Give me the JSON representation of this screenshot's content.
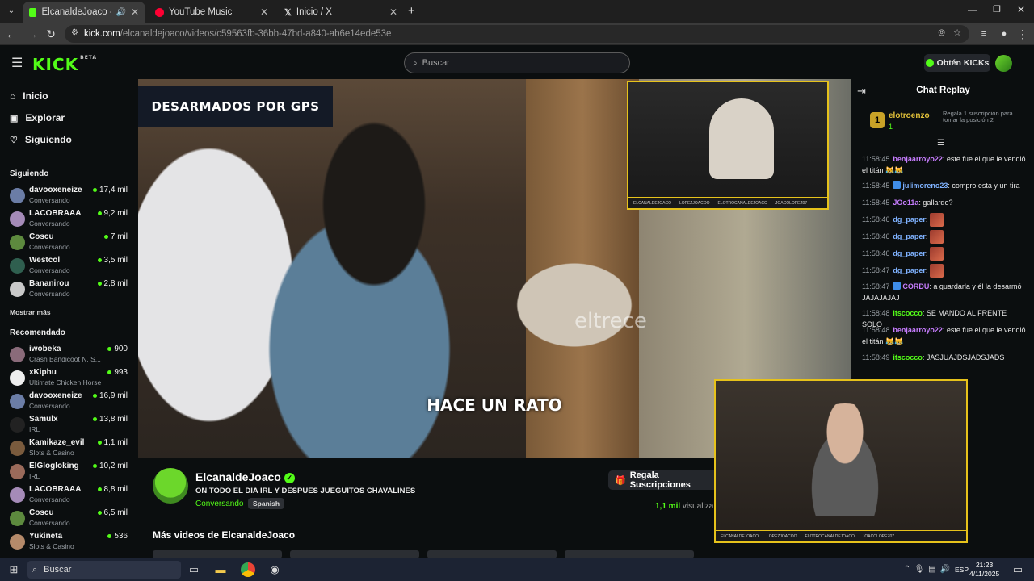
{
  "browser": {
    "tabs": [
      {
        "title": "ElcanaldeJoaco - Watch the"
      },
      {
        "title": "YouTube Music"
      },
      {
        "title": "Inicio / X"
      }
    ],
    "url_host": "kick.com",
    "url_path": "/elcanaldejoaco/videos/c59563fb-36bb-47bd-a840-ab6e14ede53e"
  },
  "header": {
    "logo": "KICK",
    "logo_tag": "BETA",
    "search_placeholder": "Buscar",
    "get_kicks": "Obtén KICKs"
  },
  "sidebar": {
    "nav": [
      {
        "label": "Inicio",
        "icon": "home-icon"
      },
      {
        "label": "Explorar",
        "icon": "compass-icon"
      },
      {
        "label": "Siguiendo",
        "icon": "heart-icon"
      }
    ],
    "following_title": "Siguiendo",
    "following": [
      {
        "name": "davooxeneize",
        "category": "Conversando",
        "viewers": "17,4 mil"
      },
      {
        "name": "LACOBRAAA",
        "category": "Conversando",
        "viewers": "9,2 mil"
      },
      {
        "name": "Coscu",
        "category": "Conversando",
        "viewers": "7 mil"
      },
      {
        "name": "Westcol",
        "category": "Conversando",
        "viewers": "3,5 mil"
      },
      {
        "name": "Bananirou",
        "category": "Conversando",
        "viewers": "2,8 mil"
      }
    ],
    "show_more": "Mostrar más",
    "recommended_title": "Recomendado",
    "recommended": [
      {
        "name": "iwobeka",
        "category": "Crash Bandicoot N. S...",
        "viewers": "900"
      },
      {
        "name": "xKiphu",
        "category": "Ultimate Chicken Horse",
        "viewers": "993"
      },
      {
        "name": "davooxeneize",
        "category": "Conversando",
        "viewers": "16,9 mil"
      },
      {
        "name": "Samulx",
        "category": "IRL",
        "viewers": "13,8 mil"
      },
      {
        "name": "Kamikaze_evil",
        "category": "Slots & Casino",
        "viewers": "1,1 mil"
      },
      {
        "name": "ElGlogloking",
        "category": "IRL",
        "viewers": "10,2 mil"
      },
      {
        "name": "LACOBRAAA",
        "category": "Conversando",
        "viewers": "8,8 mil"
      },
      {
        "name": "Coscu",
        "category": "Conversando",
        "viewers": "6,5 mil"
      },
      {
        "name": "Yukineta",
        "category": "Slots & Casino",
        "viewers": "536"
      }
    ]
  },
  "video": {
    "banner": "DESARMADOS POR GPS",
    "subtitle": "HACE UN RATO",
    "watermark": "eltrece",
    "pip_strip": [
      "ELCANALDEJOACO",
      "LOPEZJOACOO",
      "ELOTROCANALDEJOACO",
      "JOACOLOPEZ07"
    ]
  },
  "channel": {
    "name": "ElcanaldeJoaco",
    "title": "ON TODO EL DIA IRL Y DESPUES JUEGUITOS CHAVALINES",
    "category": "Conversando",
    "language": "Spanish",
    "gift_button": "Regala Suscripciones",
    "views_count": "1,1 mil",
    "views_label": "visualiza",
    "more_videos": "Más videos de ElcanaldeJoaco"
  },
  "chat": {
    "title": "Chat Replay",
    "pinned": {
      "rank": "1",
      "name": "elotroenzo",
      "count": "1",
      "gift_text": "Regala 1 suscripción para tomar la posición 2"
    },
    "messages": [
      {
        "time": "11:58:45",
        "user": "benjaarroyo22",
        "color": "#c77dff",
        "text": "este fue el que le vendió el titán 😹😹"
      },
      {
        "time": "11:58:45",
        "user": "julimoreno23",
        "color": "#7fb2ff",
        "text": "compro esta y un tira"
      },
      {
        "time": "11:58:45",
        "user": "JOo11a",
        "color": "#c77dff",
        "text": "gallardo?"
      },
      {
        "time": "11:58:46",
        "user": "dg_paper",
        "color": "#7fb2ff",
        "text": ""
      },
      {
        "time": "11:58:46",
        "user": "dg_paper",
        "color": "#7fb2ff",
        "text": ""
      },
      {
        "time": "11:58:46",
        "user": "dg_paper",
        "color": "#7fb2ff",
        "text": ""
      },
      {
        "time": "11:58:47",
        "user": "dg_paper",
        "color": "#7fb2ff",
        "text": ""
      },
      {
        "time": "11:58:47",
        "user": "CORDU",
        "color": "#c77dff",
        "text": "a guardarla y él la desarmó JAJAJAJAJ"
      },
      {
        "time": "11:58:48",
        "user": "itscocco",
        "color": "#53fc18",
        "text": "SE MANDO AL FRENTE SOLO"
      },
      {
        "time": "11:58:48",
        "user": "benjaarroyo22",
        "color": "#c77dff",
        "text": "este fue el que le vendió el titán 😹😹"
      },
      {
        "time": "11:58:49",
        "user": "itscocco",
        "color": "#53fc18",
        "text": "JASJUAJDSJADSJADS"
      }
    ]
  },
  "taskbar": {
    "search": "Buscar",
    "lang": "ESP",
    "time": "21:23",
    "date": "4/11/2025"
  }
}
